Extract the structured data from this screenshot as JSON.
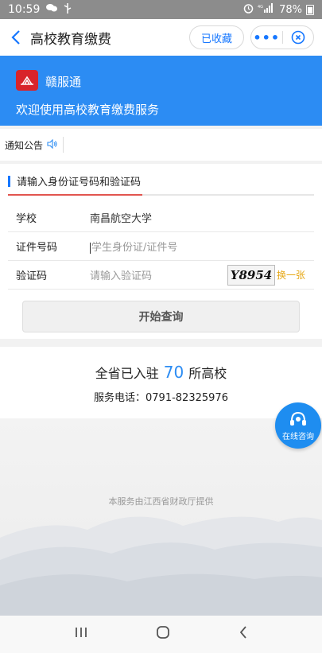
{
  "status_bar": {
    "time": "10:59",
    "battery": "78%"
  },
  "nav": {
    "title": "高校教育缴费",
    "favorited_label": "已收藏",
    "more_label": "•••"
  },
  "banner": {
    "app_name": "赣服通",
    "welcome": "欢迎使用高校教育缴费服务"
  },
  "notice": {
    "label": "通知公告"
  },
  "form": {
    "section_title": "请输入身份证号码和验证码",
    "progress": 0.44,
    "rows": [
      {
        "label": "学校",
        "value": "南昌航空大学"
      },
      {
        "label": "证件号码",
        "placeholder": "学生身份证/证件号"
      },
      {
        "label": "验证码",
        "placeholder": "请输入验证码",
        "captcha": "Y8954",
        "refresh": "换一张"
      }
    ],
    "submit_label": "开始查询"
  },
  "stats": {
    "prefix": "全省已入驻",
    "count": "70",
    "suffix": "所高校",
    "phone": "服务电话：0791-82325976"
  },
  "footer": {
    "provider": "本服务由江西省财政厅提供"
  },
  "consult": {
    "label": "在线咨询"
  },
  "colors": {
    "brand_blue": "#2c8cf3",
    "accent_red": "#e2554f",
    "captcha_link": "#e6a817"
  }
}
